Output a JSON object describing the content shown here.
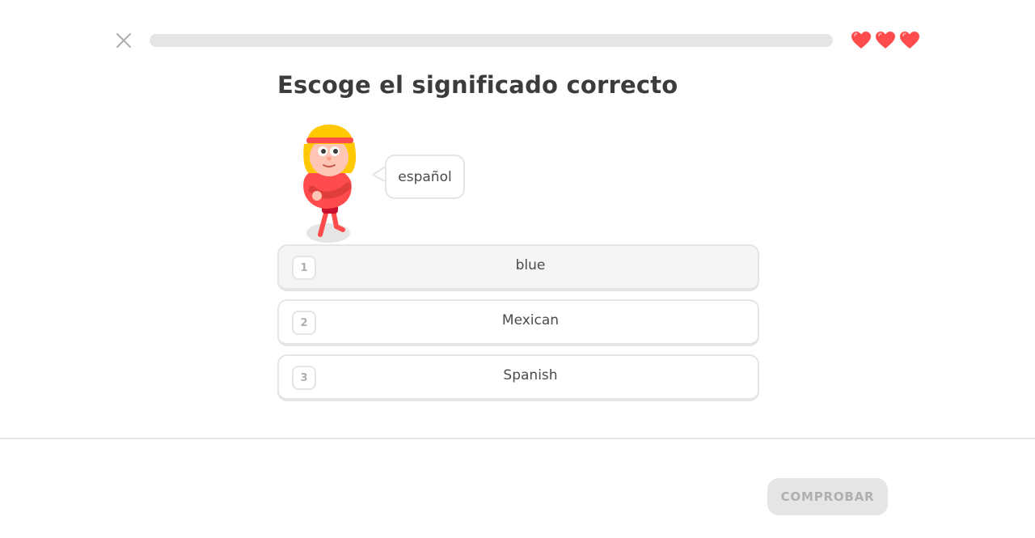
{
  "header": {
    "close_icon": "close-icon",
    "progress_fraction": 0.0,
    "hearts": [
      "heart-icon",
      "heart-icon",
      "heart-icon"
    ],
    "heart_color": "#ff4b4b"
  },
  "challenge": {
    "title": "Escoge el significado correcto",
    "character_icon": "character-illustration",
    "prompt_word": "español"
  },
  "options": [
    {
      "key": "1",
      "label": "blue"
    },
    {
      "key": "2",
      "label": "Mexican"
    },
    {
      "key": "3",
      "label": "Spanish"
    }
  ],
  "footer": {
    "check_label": "COMPROBAR"
  }
}
